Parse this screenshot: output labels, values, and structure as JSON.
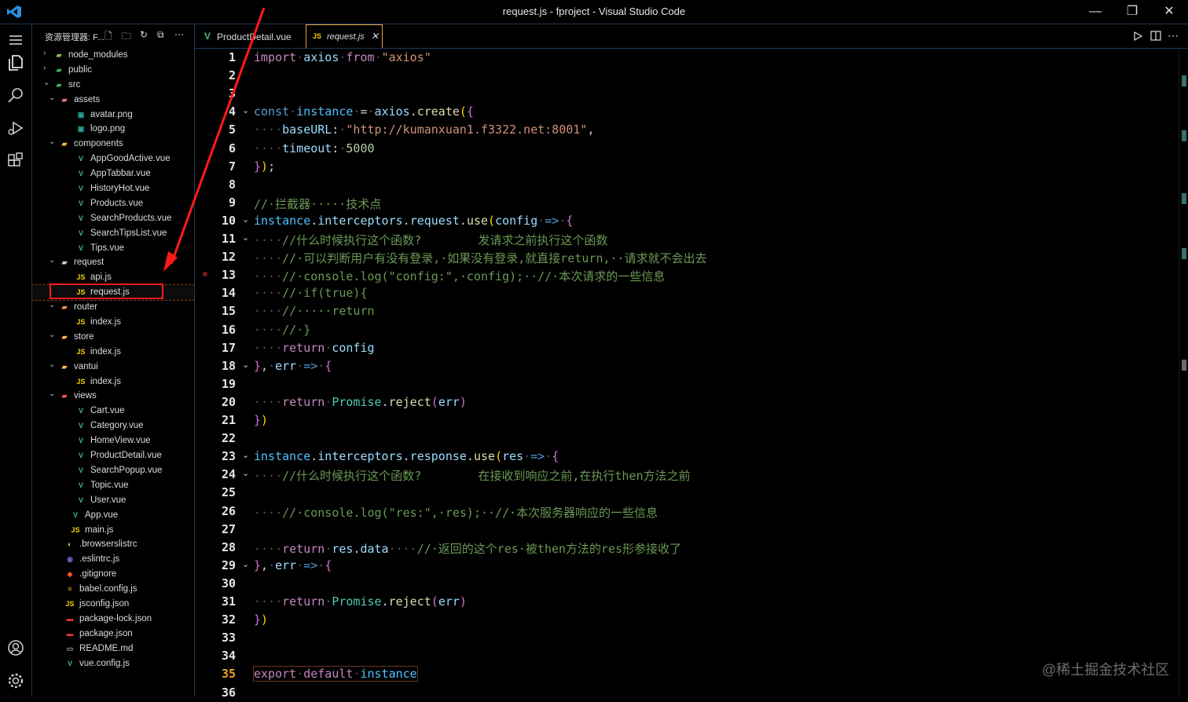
{
  "window": {
    "title": "request.js - fproject - Visual Studio Code",
    "minimize": "—",
    "restore": "❐",
    "close": "✕"
  },
  "sidebar": {
    "title": "资源管理器: F...",
    "tree": [
      {
        "name": "node_modules",
        "depth": 0,
        "type": "folder",
        "open": false,
        "icon": "folder-node-icon",
        "color": "#8bc34a"
      },
      {
        "name": "public",
        "depth": 0,
        "type": "folder",
        "open": false,
        "icon": "folder-public-icon",
        "color": "#4caf50"
      },
      {
        "name": "src",
        "depth": 0,
        "type": "folder",
        "open": true,
        "icon": "folder-src-icon",
        "color": "#4caf50"
      },
      {
        "name": "assets",
        "depth": 1,
        "type": "folder",
        "open": true,
        "icon": "folder-assets-icon",
        "color": "#e57373"
      },
      {
        "name": "avatar.png",
        "depth": 2,
        "type": "file",
        "icon": "image-file-icon",
        "color": "#26a69a"
      },
      {
        "name": "logo.png",
        "depth": 2,
        "type": "file",
        "icon": "image-file-icon",
        "color": "#26a69a"
      },
      {
        "name": "components",
        "depth": 1,
        "type": "folder",
        "open": true,
        "icon": "folder-components-icon",
        "color": "#ffb74d"
      },
      {
        "name": "AppGoodActive.vue",
        "depth": 2,
        "type": "file",
        "icon": "vue-file-icon",
        "color": "#41b883"
      },
      {
        "name": "AppTabbar.vue",
        "depth": 2,
        "type": "file",
        "icon": "vue-file-icon",
        "color": "#41b883"
      },
      {
        "name": "HistoryHot.vue",
        "depth": 2,
        "type": "file",
        "icon": "vue-file-icon",
        "color": "#41b883"
      },
      {
        "name": "Products.vue",
        "depth": 2,
        "type": "file",
        "icon": "vue-file-icon",
        "color": "#41b883"
      },
      {
        "name": "SearchProducts.vue",
        "depth": 2,
        "type": "file",
        "icon": "vue-file-icon",
        "color": "#41b883"
      },
      {
        "name": "SearchTipsList.vue",
        "depth": 2,
        "type": "file",
        "icon": "vue-file-icon",
        "color": "#41b883"
      },
      {
        "name": "Tips.vue",
        "depth": 2,
        "type": "file",
        "icon": "vue-file-icon",
        "color": "#41b883"
      },
      {
        "name": "request",
        "depth": 1,
        "type": "folder",
        "open": true,
        "icon": "folder-icon",
        "color": "#ccc"
      },
      {
        "name": "api.js",
        "depth": 2,
        "type": "file",
        "icon": "js-file-icon",
        "color": "#f5d100"
      },
      {
        "name": "request.js",
        "depth": 2,
        "type": "file",
        "icon": "js-file-icon",
        "color": "#f5d100",
        "selected": true
      },
      {
        "name": "router",
        "depth": 1,
        "type": "folder",
        "open": true,
        "icon": "folder-router-icon",
        "color": "#ff8a65"
      },
      {
        "name": "index.js",
        "depth": 2,
        "type": "file",
        "icon": "js-file-icon",
        "color": "#f5d100"
      },
      {
        "name": "store",
        "depth": 1,
        "type": "folder",
        "open": true,
        "icon": "folder-store-icon",
        "color": "#ffb74d"
      },
      {
        "name": "index.js",
        "depth": 2,
        "type": "file",
        "icon": "js-file-icon",
        "color": "#f5d100"
      },
      {
        "name": "vantui",
        "depth": 1,
        "type": "folder",
        "open": true,
        "icon": "folder-icon",
        "color": "#ffb74d"
      },
      {
        "name": "index.js",
        "depth": 2,
        "type": "file",
        "icon": "js-file-icon",
        "color": "#f5d100"
      },
      {
        "name": "views",
        "depth": 1,
        "type": "folder",
        "open": true,
        "icon": "folder-views-icon",
        "color": "#ef5350"
      },
      {
        "name": "Cart.vue",
        "depth": 2,
        "type": "file",
        "icon": "vue-file-icon",
        "color": "#41b883"
      },
      {
        "name": "Category.vue",
        "depth": 2,
        "type": "file",
        "icon": "vue-file-icon",
        "color": "#41b883"
      },
      {
        "name": "HomeView.vue",
        "depth": 2,
        "type": "file",
        "icon": "vue-file-icon",
        "color": "#41b883"
      },
      {
        "name": "ProductDetail.vue",
        "depth": 2,
        "type": "file",
        "icon": "vue-file-icon",
        "color": "#41b883"
      },
      {
        "name": "SearchPopup.vue",
        "depth": 2,
        "type": "file",
        "icon": "vue-file-icon",
        "color": "#41b883"
      },
      {
        "name": "Topic.vue",
        "depth": 2,
        "type": "file",
        "icon": "vue-file-icon",
        "color": "#41b883"
      },
      {
        "name": "User.vue",
        "depth": 2,
        "type": "file",
        "icon": "vue-file-icon",
        "color": "#41b883"
      },
      {
        "name": "App.vue",
        "depth": 1,
        "type": "file",
        "icon": "vue-file-icon",
        "color": "#41b883"
      },
      {
        "name": "main.js",
        "depth": 1,
        "type": "file",
        "icon": "js-file-icon",
        "color": "#f5d100"
      },
      {
        "name": ".browserslistrc",
        "depth": 0,
        "type": "file",
        "icon": "browserslist-icon",
        "color": "#ffca28"
      },
      {
        "name": ".eslintrc.js",
        "depth": 0,
        "type": "file",
        "icon": "eslint-icon",
        "color": "#7e57c2"
      },
      {
        "name": ".gitignore",
        "depth": 0,
        "type": "file",
        "icon": "git-icon",
        "color": "#f4511e"
      },
      {
        "name": "babel.config.js",
        "depth": 0,
        "type": "file",
        "icon": "babel-icon",
        "color": "#f9a825"
      },
      {
        "name": "jsconfig.json",
        "depth": 0,
        "type": "file",
        "icon": "js-file-icon",
        "color": "#f5d100"
      },
      {
        "name": "package-lock.json",
        "depth": 0,
        "type": "file",
        "icon": "npm-icon",
        "color": "#e53935"
      },
      {
        "name": "package.json",
        "depth": 0,
        "type": "file",
        "icon": "npm-icon",
        "color": "#e53935"
      },
      {
        "name": "README.md",
        "depth": 0,
        "type": "file",
        "icon": "markdown-icon",
        "color": "#90a4ae"
      },
      {
        "name": "vue.config.js",
        "depth": 0,
        "type": "file",
        "icon": "vue-config-icon",
        "color": "#41b883"
      }
    ]
  },
  "tabs": [
    {
      "label": "ProductDetail.vue",
      "icon": "vue-file-icon",
      "active": false
    },
    {
      "label": "request.js",
      "icon": "js-file-icon",
      "active": true,
      "close": "✕"
    }
  ],
  "editor": {
    "current_line": 35,
    "lines": [
      [
        [
          "import",
          "#c586c0"
        ],
        [
          "·",
          "#555"
        ],
        [
          "axios",
          "#9cdcfe"
        ],
        [
          "·",
          "#555"
        ],
        [
          "from",
          "#c586c0"
        ],
        [
          "·",
          "#555"
        ],
        [
          "\"axios\"",
          "#ce9178"
        ]
      ],
      [],
      [],
      [
        [
          "const",
          "#569cd6"
        ],
        [
          "·",
          "#555"
        ],
        [
          "instance",
          "#4fc1ff"
        ],
        [
          "·",
          "#555"
        ],
        [
          "=",
          "#d4d4d4"
        ],
        [
          "·",
          "#555"
        ],
        [
          "axios",
          "#9cdcfe"
        ],
        [
          ".",
          "#d4d4d4"
        ],
        [
          "create",
          "#dcdcaa"
        ],
        [
          "(",
          "#ffd700"
        ],
        [
          "{",
          "#da70d6"
        ]
      ],
      [
        [
          "····",
          "#555"
        ],
        [
          "baseURL",
          "#9cdcfe"
        ],
        [
          ":",
          "#d4d4d4"
        ],
        [
          "·",
          "#555"
        ],
        [
          "\"http://kumanxuan1.f3322.net:8001\"",
          "#ce9178"
        ],
        [
          ",",
          "#d4d4d4"
        ]
      ],
      [
        [
          "····",
          "#555"
        ],
        [
          "timeout",
          "#9cdcfe"
        ],
        [
          ":",
          "#d4d4d4"
        ],
        [
          "·",
          "#555"
        ],
        [
          "5000",
          "#b5cea8"
        ]
      ],
      [
        [
          "}",
          "#da70d6"
        ],
        [
          ")",
          "#ffd700"
        ],
        [
          ";",
          "#d4d4d4"
        ]
      ],
      [],
      [
        [
          "//·拦截器·····技术点",
          "#6a9955"
        ]
      ],
      [
        [
          "instance",
          "#4fc1ff"
        ],
        [
          ".",
          "#d4d4d4"
        ],
        [
          "interceptors",
          "#9cdcfe"
        ],
        [
          ".",
          "#d4d4d4"
        ],
        [
          "request",
          "#9cdcfe"
        ],
        [
          ".",
          "#d4d4d4"
        ],
        [
          "use",
          "#dcdcaa"
        ],
        [
          "(",
          "#ffd700"
        ],
        [
          "config",
          "#9cdcfe"
        ],
        [
          "·",
          "#555"
        ],
        [
          "=>",
          "#569cd6"
        ],
        [
          "·",
          "#555"
        ],
        [
          "{",
          "#da70d6"
        ]
      ],
      [
        [
          "····",
          "#555"
        ],
        [
          "//什么时候执行这个函数?        发请求之前执行这个函数",
          "#6a9955"
        ]
      ],
      [
        [
          "····",
          "#555"
        ],
        [
          "//·可以判断用户有没有登录,·如果没有登录,就直接return,··请求就不会出去",
          "#6a9955"
        ]
      ],
      [
        [
          "····",
          "#555"
        ],
        [
          "//·console.log(\"config:\",·config);··//·本次请求的一些信息",
          "#6a9955"
        ]
      ],
      [
        [
          "····",
          "#555"
        ],
        [
          "//·if(true){",
          "#6a9955"
        ]
      ],
      [
        [
          "····",
          "#555"
        ],
        [
          "//·····return",
          "#6a9955"
        ]
      ],
      [
        [
          "····",
          "#555"
        ],
        [
          "//·}",
          "#6a9955"
        ]
      ],
      [
        [
          "····",
          "#555"
        ],
        [
          "return",
          "#c586c0"
        ],
        [
          "·",
          "#555"
        ],
        [
          "config",
          "#9cdcfe"
        ]
      ],
      [
        [
          "}",
          "#da70d6"
        ],
        [
          ",",
          "#d4d4d4"
        ],
        [
          "·",
          "#555"
        ],
        [
          "err",
          "#9cdcfe"
        ],
        [
          "·",
          "#555"
        ],
        [
          "=>",
          "#569cd6"
        ],
        [
          "·",
          "#555"
        ],
        [
          "{",
          "#da70d6"
        ]
      ],
      [],
      [
        [
          "····",
          "#555"
        ],
        [
          "return",
          "#c586c0"
        ],
        [
          "·",
          "#555"
        ],
        [
          "Promise",
          "#4ec9b0"
        ],
        [
          ".",
          "#d4d4d4"
        ],
        [
          "reject",
          "#dcdcaa"
        ],
        [
          "(",
          "#da70d6"
        ],
        [
          "err",
          "#9cdcfe"
        ],
        [
          ")",
          "#da70d6"
        ]
      ],
      [
        [
          "}",
          "#da70d6"
        ],
        [
          ")",
          "#ffd700"
        ]
      ],
      [],
      [
        [
          "instance",
          "#4fc1ff"
        ],
        [
          ".",
          "#d4d4d4"
        ],
        [
          "interceptors",
          "#9cdcfe"
        ],
        [
          ".",
          "#d4d4d4"
        ],
        [
          "response",
          "#9cdcfe"
        ],
        [
          ".",
          "#d4d4d4"
        ],
        [
          "use",
          "#dcdcaa"
        ],
        [
          "(",
          "#ffd700"
        ],
        [
          "res",
          "#9cdcfe"
        ],
        [
          "·",
          "#555"
        ],
        [
          "=>",
          "#569cd6"
        ],
        [
          "·",
          "#555"
        ],
        [
          "{",
          "#da70d6"
        ]
      ],
      [
        [
          "····",
          "#555"
        ],
        [
          "//什么时候执行这个函数?        在接收到响应之前,在执行then方法之前",
          "#6a9955"
        ]
      ],
      [],
      [
        [
          "····",
          "#555"
        ],
        [
          "//·console.log(\"res:\",·res);··//·本次服务器响应的一些信息",
          "#6a9955"
        ]
      ],
      [],
      [
        [
          "····",
          "#555"
        ],
        [
          "return",
          "#c586c0"
        ],
        [
          "·",
          "#555"
        ],
        [
          "res",
          "#9cdcfe"
        ],
        [
          ".",
          "#d4d4d4"
        ],
        [
          "data",
          "#9cdcfe"
        ],
        [
          "····",
          "#555"
        ],
        [
          "//·返回的这个res·被then方法的res形参接收了",
          "#6a9955"
        ]
      ],
      [
        [
          "}",
          "#da70d6"
        ],
        [
          ",",
          "#d4d4d4"
        ],
        [
          "·",
          "#555"
        ],
        [
          "err",
          "#9cdcfe"
        ],
        [
          "·",
          "#555"
        ],
        [
          "=>",
          "#569cd6"
        ],
        [
          "·",
          "#555"
        ],
        [
          "{",
          "#da70d6"
        ]
      ],
      [],
      [
        [
          "····",
          "#555"
        ],
        [
          "return",
          "#c586c0"
        ],
        [
          "·",
          "#555"
        ],
        [
          "Promise",
          "#4ec9b0"
        ],
        [
          ".",
          "#d4d4d4"
        ],
        [
          "reject",
          "#dcdcaa"
        ],
        [
          "(",
          "#da70d6"
        ],
        [
          "err",
          "#9cdcfe"
        ],
        [
          ")",
          "#da70d6"
        ]
      ],
      [
        [
          "}",
          "#da70d6"
        ],
        [
          ")",
          "#ffd700"
        ]
      ],
      [],
      [],
      [
        [
          "export",
          "#c586c0"
        ],
        [
          "·",
          "#555"
        ],
        [
          "default",
          "#c586c0"
        ],
        [
          "·",
          "#555"
        ],
        [
          "instance",
          "#4fc1ff"
        ]
      ],
      []
    ],
    "folds": [
      4,
      10,
      11,
      18,
      23,
      24,
      29
    ]
  },
  "watermark": "@稀土掘金技术社区"
}
